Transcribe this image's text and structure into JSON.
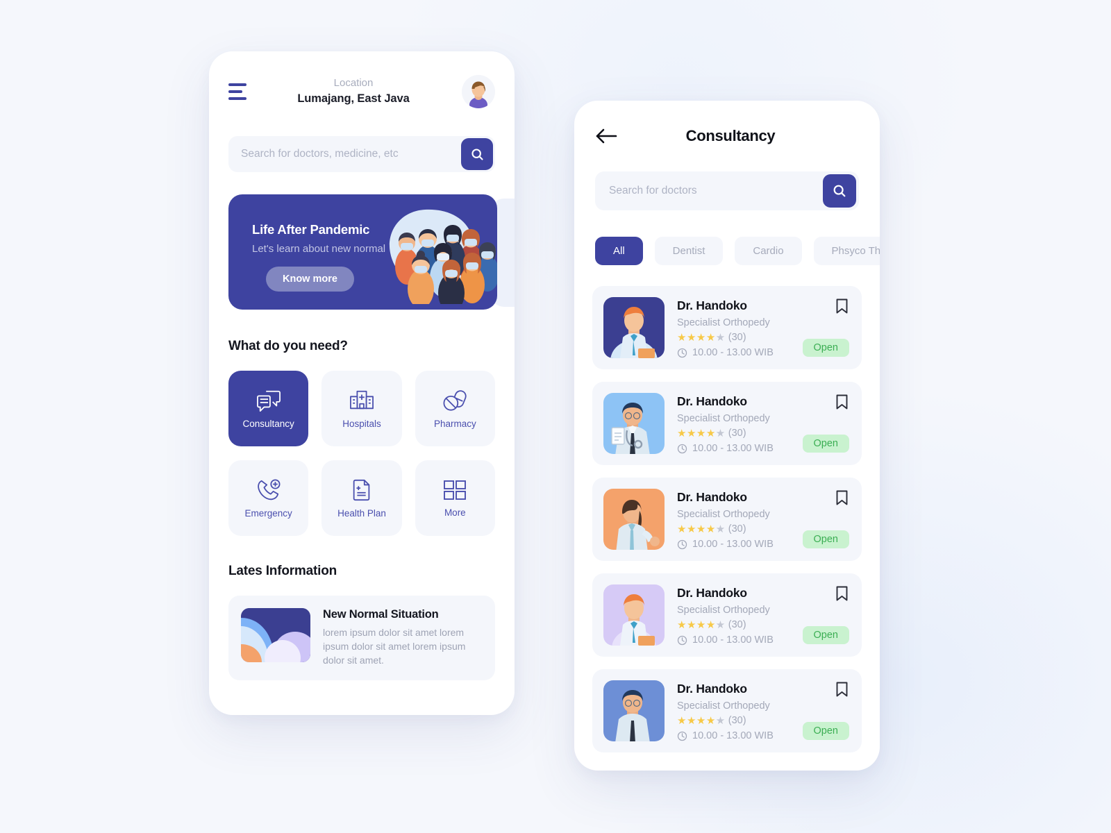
{
  "home": {
    "menu_icon": "hamburger-menu-icon",
    "location_label": "Location",
    "location_value": "Lumajang, East Java",
    "avatar_icon": "user-avatar",
    "search": {
      "placeholder": "Search for doctors, medicine, etc",
      "icon": "search-icon"
    },
    "banner": {
      "title": "Life After Pandemic",
      "subtitle": "Let's learn about new normal",
      "button": "Know more",
      "art": "crowd-with-masks-illustration"
    },
    "needs_title": "What do you need?",
    "categories": [
      {
        "label": "Consultancy",
        "icon": "chat-bubbles-icon",
        "active": true
      },
      {
        "label": "Hospitals",
        "icon": "hospital-building-icon",
        "active": false
      },
      {
        "label": "Pharmacy",
        "icon": "pills-icon",
        "active": false
      },
      {
        "label": "Emergency",
        "icon": "phone-plus-icon",
        "active": false
      },
      {
        "label": "Health Plan",
        "icon": "document-plus-icon",
        "active": false
      },
      {
        "label": "More",
        "icon": "grid-squares-icon",
        "active": false
      }
    ],
    "latest_title": "Lates Information",
    "news": {
      "title": "New Normal Situation",
      "body": "lorem ipsum dolor sit amet lorem ipsum dolor sit amet lorem ipsum dolor sit amet.",
      "thumb": "abstract-shapes-thumbnail"
    }
  },
  "list": {
    "back_icon": "arrow-left-icon",
    "title": "Consultancy",
    "search": {
      "placeholder": "Search for doctors",
      "icon": "search-icon"
    },
    "chips": [
      {
        "label": "All",
        "active": true
      },
      {
        "label": "Dentist",
        "active": false
      },
      {
        "label": "Cardio",
        "active": false
      },
      {
        "label": "Phsyco Theraphy",
        "active": false
      }
    ],
    "doctors": [
      {
        "name": "Dr. Handoko",
        "specialty": "Specialist Orthopedy",
        "stars_filled": 4,
        "stars_total": 5,
        "rating_count": "(30)",
        "hours": "10.00 - 13.00 WIB",
        "status": "Open",
        "bookmark_icon": "bookmark-icon",
        "clock_icon": "clock-icon",
        "avatar_bg": "#3b3f91",
        "avatar_variant": "male-orange-hair"
      },
      {
        "name": "Dr. Handoko",
        "specialty": "Specialist Orthopedy",
        "stars_filled": 4,
        "stars_total": 5,
        "rating_count": "(30)",
        "hours": "10.00 - 13.00 WIB",
        "status": "Open",
        "bookmark_icon": "bookmark-icon",
        "clock_icon": "clock-icon",
        "avatar_bg": "#8dc3f5",
        "avatar_variant": "male-clipboard-stethoscope"
      },
      {
        "name": "Dr. Handoko",
        "specialty": "Specialist Orthopedy",
        "stars_filled": 4,
        "stars_total": 5,
        "rating_count": "(30)",
        "hours": "10.00 - 13.00 WIB",
        "status": "Open",
        "bookmark_icon": "bookmark-icon",
        "clock_icon": "clock-icon",
        "avatar_bg": "#f4a26b",
        "avatar_variant": "female-waving"
      },
      {
        "name": "Dr. Handoko",
        "specialty": "Specialist Orthopedy",
        "stars_filled": 4,
        "stars_total": 5,
        "rating_count": "(30)",
        "hours": "10.00 - 13.00 WIB",
        "status": "Open",
        "bookmark_icon": "bookmark-icon",
        "clock_icon": "clock-icon",
        "avatar_bg": "#d6caf6",
        "avatar_variant": "male-orange-hair"
      },
      {
        "name": "Dr. Handoko",
        "specialty": "Specialist Orthopedy",
        "stars_filled": 4,
        "stars_total": 5,
        "rating_count": "(30)",
        "hours": "10.00 - 13.00 WIB",
        "status": "Open",
        "bookmark_icon": "bookmark-icon",
        "clock_icon": "clock-icon",
        "avatar_bg": "#6d8fd6",
        "avatar_variant": "male-clipboard-stethoscope"
      }
    ]
  },
  "colors": {
    "brand": "#3e43a0",
    "page_bg": "#f5f7fc",
    "surface": "#f4f6fb",
    "muted_text": "#a3a8b8",
    "star_on": "#f7c948",
    "star_off": "#c3c7d3",
    "badge_bg": "#c9f2cf",
    "badge_text": "#3bae53"
  }
}
